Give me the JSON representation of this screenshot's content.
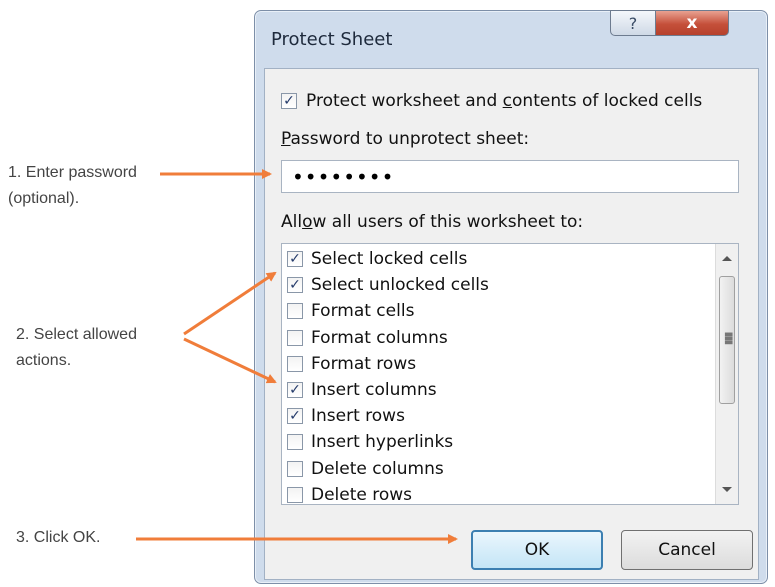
{
  "annotations": {
    "step1_line1": "1. Enter password",
    "step1_line2": "(optional).",
    "step2_line1": "2. Select allowed",
    "step2_line2": "actions.",
    "step3": "3. Click OK."
  },
  "dialog": {
    "title": "Protect Sheet",
    "help_glyph": "?",
    "close_glyph": "x",
    "protect_checkbox": {
      "label_pre": "Protect worksheet and ",
      "label_accel": "c",
      "label_post": "ontents of locked cells",
      "checked": true
    },
    "password_label_accel": "P",
    "password_label_rest": "assword to unprotect sheet:",
    "password_value": "••••••••",
    "allow_label_pre": "All",
    "allow_label_accel": "o",
    "allow_label_post": "w all users of this worksheet to:",
    "permissions": [
      {
        "label": "Select locked cells",
        "checked": true
      },
      {
        "label": "Select unlocked cells",
        "checked": true
      },
      {
        "label": "Format cells",
        "checked": false
      },
      {
        "label": "Format columns",
        "checked": false
      },
      {
        "label": "Format rows",
        "checked": false
      },
      {
        "label": "Insert columns",
        "checked": true
      },
      {
        "label": "Insert rows",
        "checked": true
      },
      {
        "label": "Insert hyperlinks",
        "checked": false
      },
      {
        "label": "Delete columns",
        "checked": false
      },
      {
        "label": "Delete rows",
        "checked": false
      }
    ],
    "ok_label": "OK",
    "cancel_label": "Cancel"
  },
  "colors": {
    "arrow": "#f07d3a",
    "check": "#243a6a"
  }
}
